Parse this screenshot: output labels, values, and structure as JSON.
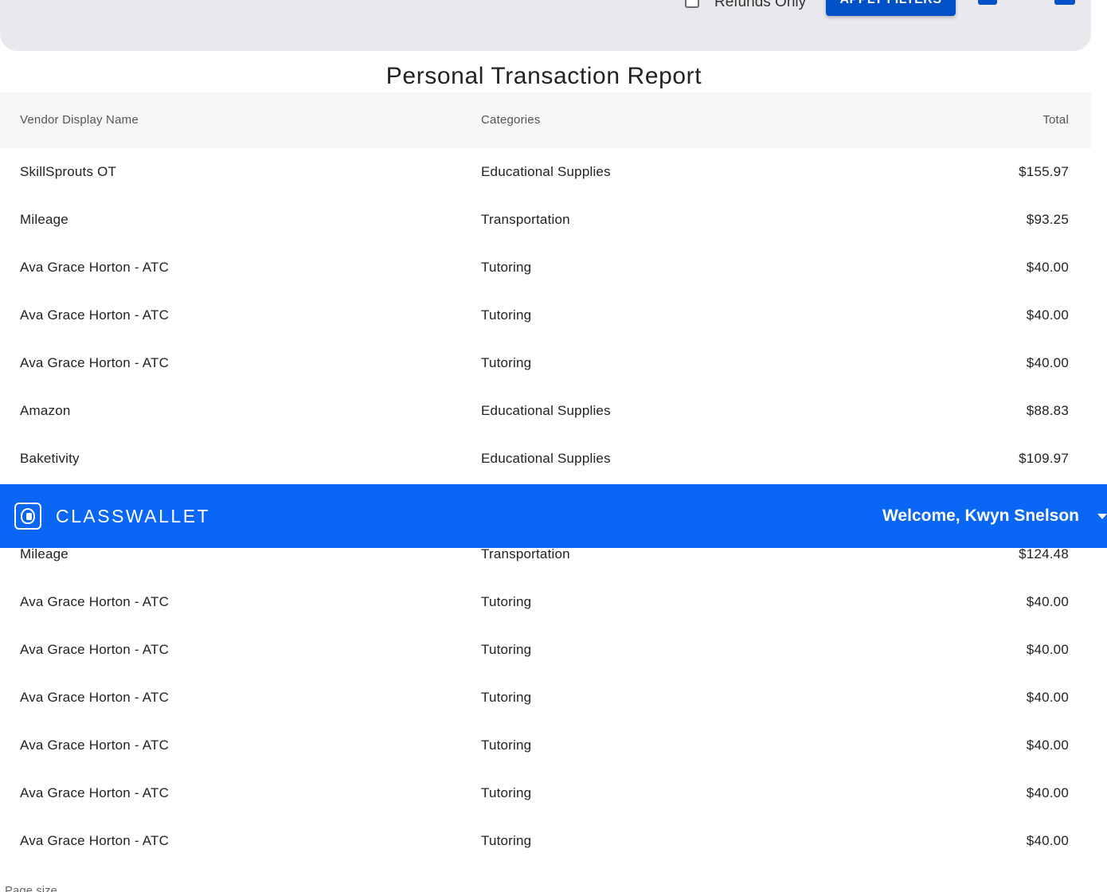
{
  "filters": {
    "refunds_only_label": "Refunds Only",
    "refunds_only_checked": false,
    "apply_button_label": "APPLY FILTERS",
    "tool_icons": [
      "print-icon",
      "list-icon",
      "save-icon"
    ]
  },
  "report": {
    "title": "Personal Transaction Report",
    "columns": {
      "vendor": "Vendor Display Name",
      "categories": "Categories",
      "total": "Total"
    },
    "rows": [
      {
        "vendor": "SkillSprouts OT",
        "category": "Educational Supplies",
        "total": "$155.97"
      },
      {
        "vendor": "Mileage",
        "category": "Transportation",
        "total": "$93.25"
      },
      {
        "vendor": "Ava Grace Horton - ATC",
        "category": "Tutoring",
        "total": "$40.00"
      },
      {
        "vendor": "Ava Grace Horton - ATC",
        "category": "Tutoring",
        "total": "$40.00"
      },
      {
        "vendor": "Ava Grace Horton - ATC",
        "category": "Tutoring",
        "total": "$40.00"
      },
      {
        "vendor": "Amazon",
        "category": "Educational Supplies",
        "total": "$88.83"
      },
      {
        "vendor": "Baketivity",
        "category": "Educational Supplies",
        "total": "$109.97"
      },
      {
        "vendor": "",
        "category": "",
        "total": ""
      },
      {
        "vendor": "Mileage",
        "category": "Transportation",
        "total": "$124.48"
      },
      {
        "vendor": "Ava Grace Horton - ATC",
        "category": "Tutoring",
        "total": "$40.00"
      },
      {
        "vendor": "Ava Grace Horton - ATC",
        "category": "Tutoring",
        "total": "$40.00"
      },
      {
        "vendor": "Ava Grace Horton - ATC",
        "category": "Tutoring",
        "total": "$40.00"
      },
      {
        "vendor": "Ava Grace Horton - ATC",
        "category": "Tutoring",
        "total": "$40.00"
      },
      {
        "vendor": "Ava Grace Horton - ATC",
        "category": "Tutoring",
        "total": "$40.00"
      },
      {
        "vendor": "Ava Grace Horton - ATC",
        "category": "Tutoring",
        "total": "$40.00"
      }
    ],
    "page_size_label": "Page size"
  },
  "navbar": {
    "brand": "CLASSWALLET",
    "welcome": "Welcome, Kwyn Snelson"
  },
  "colors": {
    "brand_blue": "#0a66f5",
    "button_blue": "#0050c8",
    "panel_gray": "#e9e8ec",
    "header_gray": "#f6f6f6"
  }
}
